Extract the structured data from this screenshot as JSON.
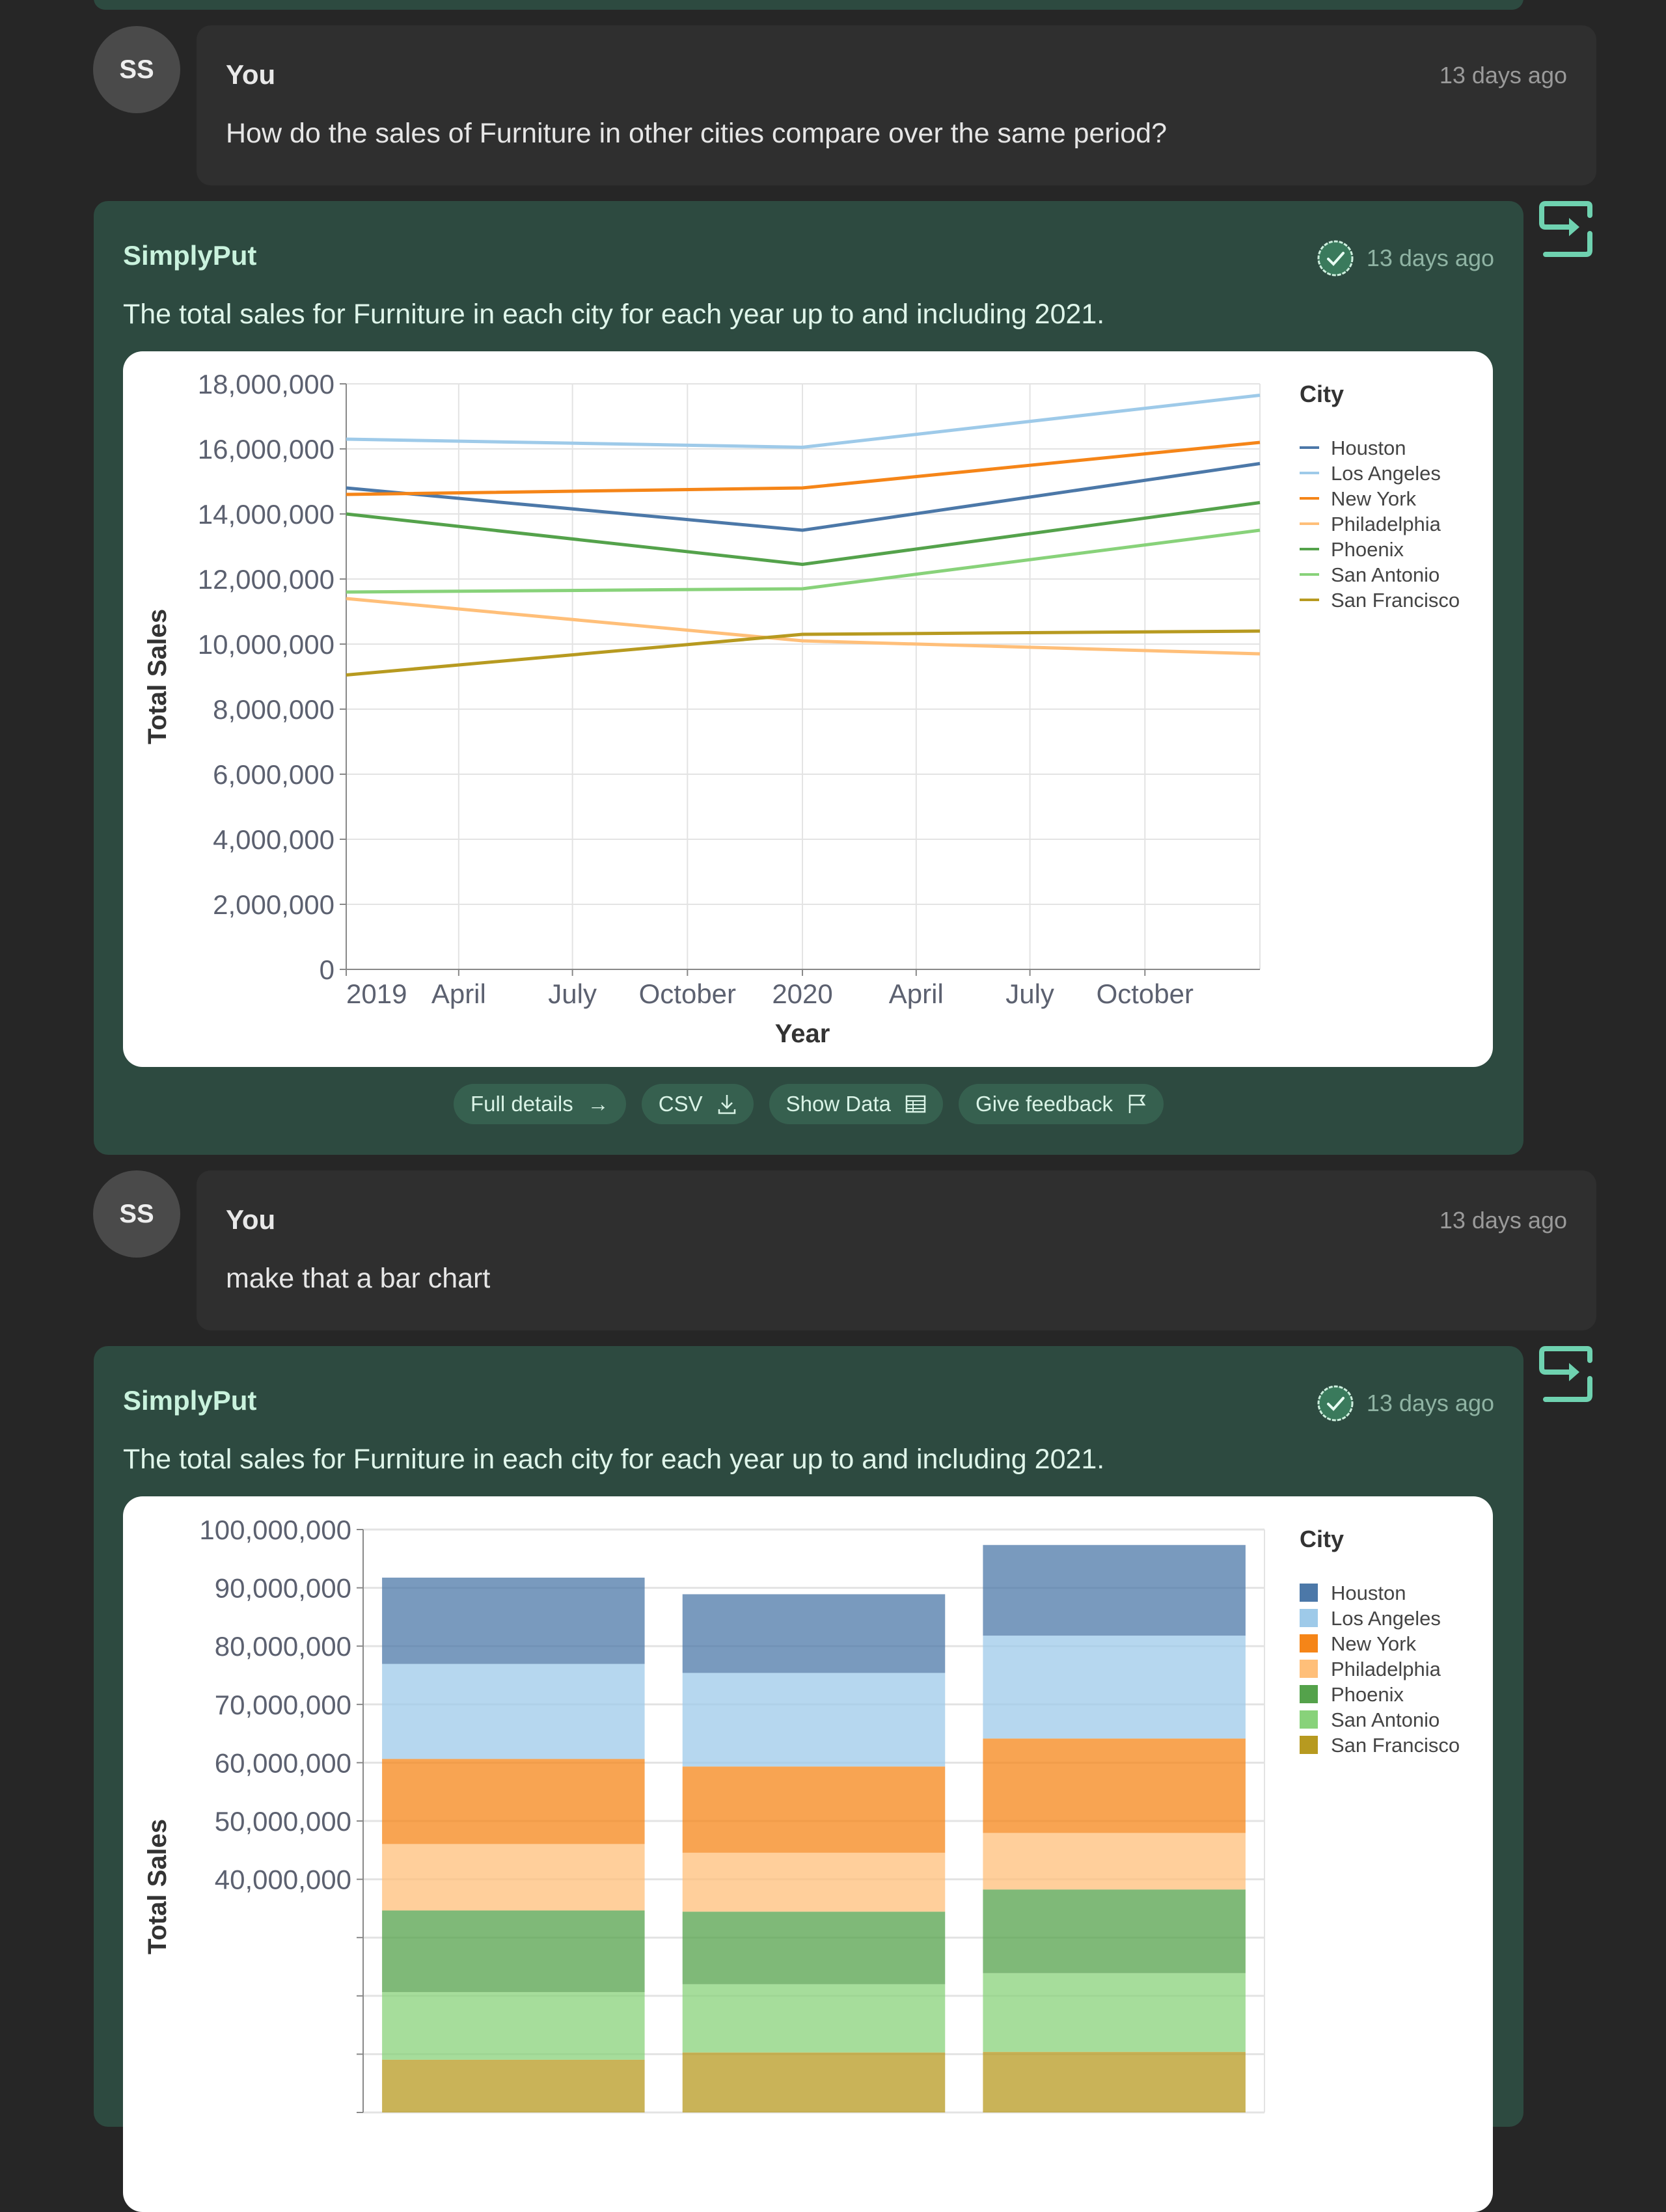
{
  "messages": [
    {
      "role": "user",
      "avatar": "SS",
      "name": "You",
      "time": "13 days ago",
      "text": "How do the sales of Furniture in other cities compare over the same period?"
    },
    {
      "role": "assistant",
      "name": "SimplyPut",
      "time": "13 days ago",
      "text": "The total sales for Furniture in each city for each year up to and including 2021.",
      "buttons": [
        {
          "label": "Full details",
          "icon": "arrow-right-icon"
        },
        {
          "label": "CSV",
          "icon": "download-icon"
        },
        {
          "label": "Show Data",
          "icon": "table-icon"
        },
        {
          "label": "Give feedback",
          "icon": "flag-icon"
        }
      ]
    },
    {
      "role": "user",
      "avatar": "SS",
      "name": "You",
      "time": "13 days ago",
      "text": "make that a bar chart"
    },
    {
      "role": "assistant",
      "name": "SimplyPut",
      "time": "13 days ago",
      "text": "The total sales for Furniture in each city for each year up to and including 2021."
    }
  ],
  "icons": {
    "verified": "check-badge-icon",
    "export": "export-arrow-icon"
  },
  "chart_data": [
    {
      "type": "line",
      "xlabel": "Year",
      "ylabel": "Total Sales",
      "x": [
        "2019-01-01",
        "2020-01-01",
        "2021-01-01"
      ],
      "xticks": [
        "2019",
        "April",
        "July",
        "October",
        "2020",
        "April",
        "July",
        "October"
      ],
      "yticks": [
        "0",
        "2,000,000",
        "4,000,000",
        "6,000,000",
        "8,000,000",
        "10,000,000",
        "12,000,000",
        "14,000,000",
        "16,000,000",
        "18,000,000"
      ],
      "ylim": [
        0,
        18000000
      ],
      "grid": true,
      "legend": {
        "title": "City",
        "placement": "right"
      },
      "series": [
        {
          "name": "Houston",
          "color": "#4c78a8",
          "values": [
            14800000,
            13500000,
            15550000
          ]
        },
        {
          "name": "Los Angeles",
          "color": "#9ecae9",
          "values": [
            16300000,
            16050000,
            17650000
          ]
        },
        {
          "name": "New York",
          "color": "#f58518",
          "values": [
            14600000,
            14800000,
            16200000
          ]
        },
        {
          "name": "Philadelphia",
          "color": "#ffbf79",
          "values": [
            11400000,
            10100000,
            9700000
          ]
        },
        {
          "name": "Phoenix",
          "color": "#54a24b",
          "values": [
            14000000,
            12450000,
            14350000
          ]
        },
        {
          "name": "San Antonio",
          "color": "#88d27a",
          "values": [
            11600000,
            11700000,
            13500000
          ]
        },
        {
          "name": "San Francisco",
          "color": "#b79a20",
          "values": [
            9050000,
            10300000,
            10400000
          ]
        }
      ]
    },
    {
      "type": "bar",
      "stacked": true,
      "ylabel": "Total Sales",
      "yticks": [
        "40,000,000",
        "50,000,000",
        "60,000,000",
        "70,000,000",
        "80,000,000",
        "90,000,000",
        "100,000,000"
      ],
      "ylim": [
        0,
        100000000
      ],
      "grid": true,
      "legend": {
        "title": "City",
        "placement": "right"
      },
      "series": [
        {
          "name": "Houston",
          "color": "#4c78a8",
          "values": [
            14800000,
            13500000,
            15550000
          ]
        },
        {
          "name": "Los Angeles",
          "color": "#9ecae9",
          "values": [
            16300000,
            16050000,
            17650000
          ]
        },
        {
          "name": "New York",
          "color": "#f58518",
          "values": [
            14600000,
            14800000,
            16200000
          ]
        },
        {
          "name": "Philadelphia",
          "color": "#ffbf79",
          "values": [
            11400000,
            10100000,
            9700000
          ]
        },
        {
          "name": "Phoenix",
          "color": "#54a24b",
          "values": [
            14000000,
            12450000,
            14350000
          ]
        },
        {
          "name": "San Antonio",
          "color": "#88d27a",
          "values": [
            11600000,
            11700000,
            13500000
          ]
        },
        {
          "name": "San Francisco",
          "color": "#b79a20",
          "values": [
            9050000,
            10300000,
            10400000
          ]
        }
      ]
    }
  ]
}
